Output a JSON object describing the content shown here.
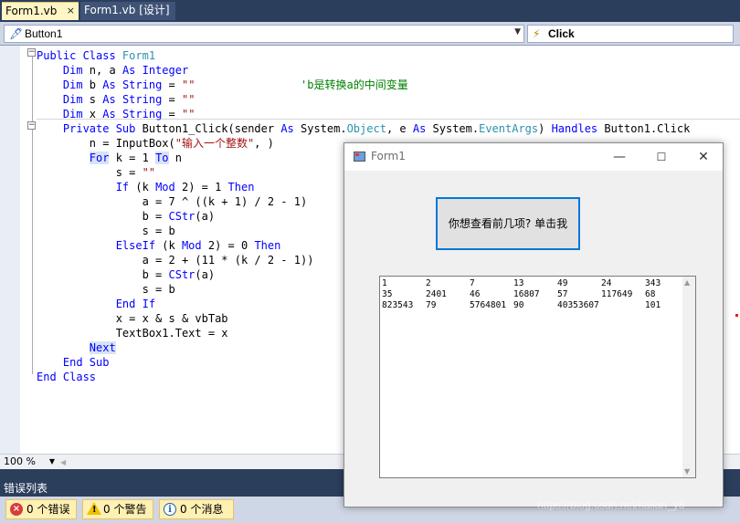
{
  "tabs": [
    {
      "label": "Form1.vb",
      "active": true,
      "close": "×"
    },
    {
      "label": "Form1.vb [设计]",
      "active": false
    }
  ],
  "nav": {
    "object": "Button1",
    "object_icon": "class-member-icon",
    "event": "Click",
    "event_icon": "lightning-event-icon"
  },
  "code": {
    "lines": [
      [
        {
          "t": "Public Class ",
          "c": "kw"
        },
        {
          "t": "Form1",
          "c": "ty"
        }
      ],
      [
        {
          "t": "    Dim",
          "c": "kw"
        },
        {
          "t": " n, a "
        },
        {
          "t": "As Integer",
          "c": "kw"
        }
      ],
      [
        {
          "t": "    Dim",
          "c": "kw"
        },
        {
          "t": " b "
        },
        {
          "t": "As String",
          "c": "kw"
        },
        {
          "t": " = "
        },
        {
          "t": "\"\"",
          "c": "str"
        },
        {
          "t": "                "
        },
        {
          "t": "'b是转换a的中间变量",
          "c": "cmt"
        }
      ],
      [
        {
          "t": "    Dim",
          "c": "kw"
        },
        {
          "t": " s "
        },
        {
          "t": "As String",
          "c": "kw"
        },
        {
          "t": " = "
        },
        {
          "t": "\"\"",
          "c": "str"
        }
      ],
      [
        {
          "t": "    Dim",
          "c": "kw"
        },
        {
          "t": " x "
        },
        {
          "t": "As String",
          "c": "kw"
        },
        {
          "t": " = "
        },
        {
          "t": "\"\"",
          "c": "str"
        }
      ],
      [
        {
          "t": "    Private Sub",
          "c": "kw"
        },
        {
          "t": " Button1_Click(sender "
        },
        {
          "t": "As",
          "c": "kw"
        },
        {
          "t": " System."
        },
        {
          "t": "Object",
          "c": "ty"
        },
        {
          "t": ", e "
        },
        {
          "t": "As",
          "c": "kw"
        },
        {
          "t": " System."
        },
        {
          "t": "EventArgs",
          "c": "ty"
        },
        {
          "t": ") "
        },
        {
          "t": "Handles",
          "c": "kw"
        },
        {
          "t": " Button1.Click"
        }
      ],
      [
        {
          "t": "        n = InputBox("
        },
        {
          "t": "\"输入一个整数\"",
          "c": "str"
        },
        {
          "t": ", )"
        }
      ],
      [
        {
          "t": "        "
        },
        {
          "t": "For",
          "c": "kw hl"
        },
        {
          "t": " k = 1 "
        },
        {
          "t": "To",
          "c": "kw hl"
        },
        {
          "t": " n"
        }
      ],
      [
        {
          "t": "            s = "
        },
        {
          "t": "\"\"",
          "c": "str"
        }
      ],
      [
        {
          "t": "            "
        },
        {
          "t": "If",
          "c": "kw"
        },
        {
          "t": " (k "
        },
        {
          "t": "Mod",
          "c": "kw"
        },
        {
          "t": " 2) = 1 "
        },
        {
          "t": "Then",
          "c": "kw"
        }
      ],
      [
        {
          "t": "                a = 7 ^ ((k + 1) / 2 - 1)"
        }
      ],
      [
        {
          "t": "                b = "
        },
        {
          "t": "CStr",
          "c": "kw"
        },
        {
          "t": "(a)"
        }
      ],
      [
        {
          "t": "                s = b"
        }
      ],
      [
        {
          "t": "            ElseIf",
          "c": "kw"
        },
        {
          "t": " (k "
        },
        {
          "t": "Mod",
          "c": "kw"
        },
        {
          "t": " 2) = 0 "
        },
        {
          "t": "Then",
          "c": "kw"
        }
      ],
      [
        {
          "t": "                a = 2 + (11 * (k / 2 - 1))"
        }
      ],
      [
        {
          "t": "                b = "
        },
        {
          "t": "CStr",
          "c": "kw"
        },
        {
          "t": "(a)"
        }
      ],
      [
        {
          "t": "                s = b"
        }
      ],
      [
        {
          "t": "            End If",
          "c": "kw"
        }
      ],
      [
        {
          "t": "            x = x & s & vbTab"
        }
      ],
      [
        {
          "t": "            TextBox1.Text = x"
        }
      ],
      [
        {
          "t": "        "
        },
        {
          "t": "Next",
          "c": "kw hl"
        }
      ],
      [
        {
          "t": "    End Sub",
          "c": "kw"
        }
      ],
      [
        {
          "t": "End Class",
          "c": "kw"
        }
      ]
    ]
  },
  "editor_status": {
    "zoom": "100 %"
  },
  "error_list": {
    "title": "错误列表",
    "errors": "0 个错误",
    "warnings": "0 个警告",
    "messages": "0 个消息"
  },
  "form": {
    "title": "Form1",
    "button_label": "你想查看前几项? 单击我",
    "textbox_rows": [
      [
        "1",
        "2",
        "7",
        "13",
        "49",
        "24",
        "343"
      ],
      [
        "35",
        "2401",
        "46",
        "16807",
        "57",
        "117649",
        "68"
      ],
      [
        "823543",
        "79",
        "5764801",
        "90",
        "40353607",
        "",
        "101"
      ]
    ]
  },
  "watermark": "https://blog.csdn.net/kailan_y8"
}
